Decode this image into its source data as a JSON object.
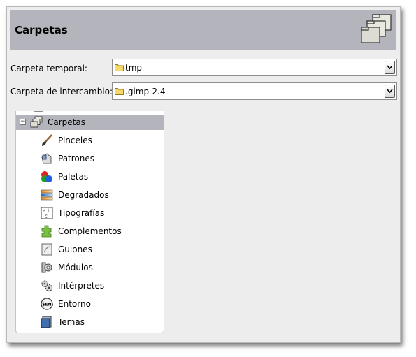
{
  "header": {
    "title": "Carpetas"
  },
  "fields": [
    {
      "label": "Carpeta temporal:",
      "value": "tmp"
    },
    {
      "label": "Carpeta de intercambio:",
      "value": ".gimp-2.4"
    }
  ],
  "tree": {
    "parent": {
      "label": "Carpetas",
      "expander": "−"
    },
    "items": [
      {
        "label": "Pinceles",
        "icon": "brush-icon"
      },
      {
        "label": "Patrones",
        "icon": "pattern-icon"
      },
      {
        "label": "Paletas",
        "icon": "palette-icon"
      },
      {
        "label": "Degradados",
        "icon": "gradient-icon"
      },
      {
        "label": "Tipografías",
        "icon": "font-icon"
      },
      {
        "label": "Complementos",
        "icon": "plugin-icon"
      },
      {
        "label": "Guiones",
        "icon": "script-icon"
      },
      {
        "label": "Módulos",
        "icon": "module-icon"
      },
      {
        "label": "Intérpretes",
        "icon": "interpreter-icon"
      },
      {
        "label": "Entorno",
        "icon": "environment-icon"
      },
      {
        "label": "Temas",
        "icon": "theme-icon"
      }
    ]
  },
  "colors": {
    "header_bg": "#b4b5bc",
    "selection_bg": "#b4b5bc",
    "window_bg": "#ededed"
  }
}
